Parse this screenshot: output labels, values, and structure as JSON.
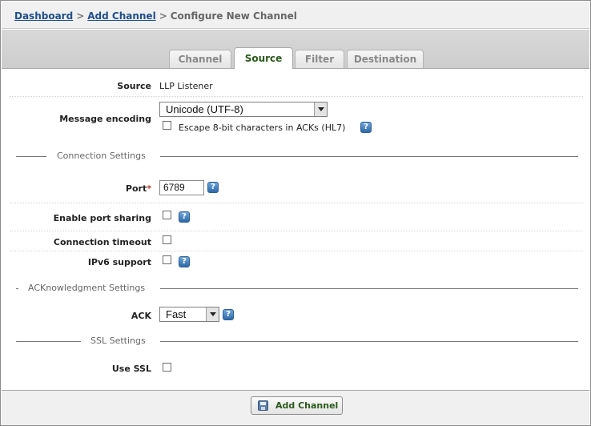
{
  "breadcrumb": {
    "items": [
      "Dashboard",
      "Add Channel"
    ],
    "separator": ">",
    "current": "Configure New Channel"
  },
  "tabs": [
    {
      "label": "Channel",
      "active": false
    },
    {
      "label": "Source",
      "active": true
    },
    {
      "label": "Filter",
      "active": false
    },
    {
      "label": "Destination",
      "active": false
    }
  ],
  "form": {
    "source": {
      "label": "Source",
      "value": "LLP Listener"
    },
    "message_encoding": {
      "label": "Message encoding",
      "selected": "Unicode (UTF-8)",
      "escape_checkbox_label": "Escape 8-bit characters in ACKs (HL7)",
      "escape_checked": false
    },
    "connection_section_title": "Connection Settings",
    "port": {
      "label": "Port",
      "required_mark": "*",
      "value": "6789"
    },
    "port_sharing": {
      "label": "Enable port sharing",
      "checked": false
    },
    "connection_timeout": {
      "label": "Connection timeout",
      "checked": false
    },
    "ipv6": {
      "label": "IPv6 support",
      "checked": false
    },
    "ack_section_title": "ACKnowledgment Settings",
    "ack": {
      "label": "ACK",
      "selected": "Fast"
    },
    "ssl_section_title": "SSL Settings",
    "use_ssl": {
      "label": "Use SSL",
      "checked": false
    }
  },
  "footer": {
    "add_channel_label": "Add Channel"
  },
  "help_icon_glyph": "?",
  "colors": {
    "link": "#1f4e8c",
    "active_tab_text": "#2a5a1a",
    "help_icon": "#3c78b8",
    "required": "#c0392b"
  }
}
